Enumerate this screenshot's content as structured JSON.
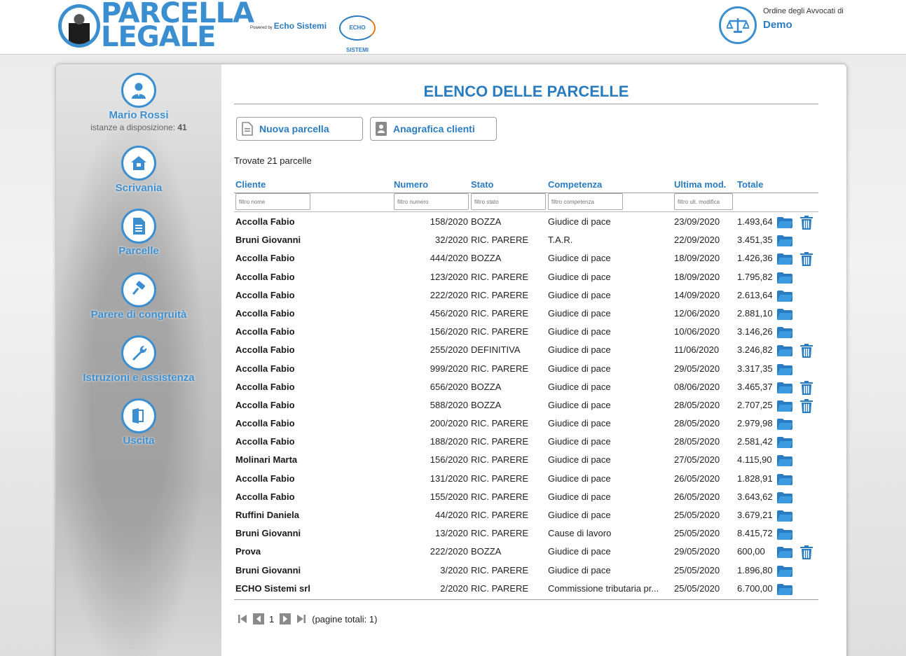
{
  "header": {
    "logo_line1_a": "PARCELLA",
    "logo_line2": "LEGALE",
    "powered_by": "Powered by",
    "powered_brand": "Echo Sistemi",
    "echo_logo_text": "ECHO SISTEMI",
    "order_label": "Ordine degli Avvocati di",
    "order_name": "Demo"
  },
  "sidebar": {
    "user_name": "Mario Rossi",
    "instances_label": "istanze a disposizione:",
    "instances_count": "41",
    "items": [
      {
        "label": "Scrivania",
        "icon": "house-icon"
      },
      {
        "label": "Parcelle",
        "icon": "document-icon"
      },
      {
        "label": "Parere di congruità",
        "icon": "gavel-icon"
      },
      {
        "label": "Istruzioni e assistenza",
        "icon": "wrench-icon"
      },
      {
        "label": "Uscita",
        "icon": "exit-door-icon"
      }
    ]
  },
  "main": {
    "title": "ELENCO DELLE PARCELLE",
    "new_button": "Nuova parcella",
    "clients_button": "Anagrafica clienti",
    "found_text": "Trovate 21 parcelle",
    "columns": {
      "cliente": "Cliente",
      "numero": "Numero",
      "stato": "Stato",
      "competenza": "Competenza",
      "ultima_mod": "Ultima mod.",
      "totale": "Totale"
    },
    "filters": {
      "nome": "filtro nome",
      "numero": "filtro numero",
      "stato": "filtro stato",
      "competenza": "filtro competenza",
      "ult_modifica": "filtro ult. modifica"
    },
    "rows": [
      {
        "cliente": "Accolla Fabio",
        "numero": "158/2020",
        "stato": "BOZZA",
        "competenza": "Giudice di pace",
        "data": "23/09/2020",
        "totale": "1.493,64",
        "deletable": true
      },
      {
        "cliente": "Bruni Giovanni",
        "numero": "32/2020",
        "stato": "RIC. PARERE",
        "competenza": "T.A.R.",
        "data": "22/09/2020",
        "totale": "3.451,35",
        "deletable": false
      },
      {
        "cliente": "Accolla Fabio",
        "numero": "444/2020",
        "stato": "BOZZA",
        "competenza": "Giudice di pace",
        "data": "18/09/2020",
        "totale": "1.426,36",
        "deletable": true
      },
      {
        "cliente": "Accolla Fabio",
        "numero": "123/2020",
        "stato": "RIC. PARERE",
        "competenza": "Giudice di pace",
        "data": "18/09/2020",
        "totale": "1.795,82",
        "deletable": false
      },
      {
        "cliente": "Accolla Fabio",
        "numero": "222/2020",
        "stato": "RIC. PARERE",
        "competenza": "Giudice di pace",
        "data": "14/09/2020",
        "totale": "2.613,64",
        "deletable": false
      },
      {
        "cliente": "Accolla Fabio",
        "numero": "456/2020",
        "stato": "RIC. PARERE",
        "competenza": "Giudice di pace",
        "data": "12/06/2020",
        "totale": "2.881,10",
        "deletable": false
      },
      {
        "cliente": "Accolla Fabio",
        "numero": "156/2020",
        "stato": "RIC. PARERE",
        "competenza": "Giudice di pace",
        "data": "10/06/2020",
        "totale": "3.146,26",
        "deletable": false
      },
      {
        "cliente": "Accolla Fabio",
        "numero": "255/2020",
        "stato": "DEFINITIVA",
        "competenza": "Giudice di pace",
        "data": "11/06/2020",
        "totale": "3.246,82",
        "deletable": true
      },
      {
        "cliente": "Accolla Fabio",
        "numero": "999/2020",
        "stato": "RIC. PARERE",
        "competenza": "Giudice di pace",
        "data": "29/05/2020",
        "totale": "3.317,35",
        "deletable": false
      },
      {
        "cliente": "Accolla Fabio",
        "numero": "656/2020",
        "stato": "BOZZA",
        "competenza": "Giudice di pace",
        "data": "08/06/2020",
        "totale": "3.465,37",
        "deletable": true
      },
      {
        "cliente": "Accolla Fabio",
        "numero": "588/2020",
        "stato": "BOZZA",
        "competenza": "Giudice di pace",
        "data": "28/05/2020",
        "totale": "2.707,25",
        "deletable": true
      },
      {
        "cliente": "Accolla Fabio",
        "numero": "200/2020",
        "stato": "RIC. PARERE",
        "competenza": "Giudice di pace",
        "data": "28/05/2020",
        "totale": "2.979,98",
        "deletable": false
      },
      {
        "cliente": "Accolla Fabio",
        "numero": "188/2020",
        "stato": "RIC. PARERE",
        "competenza": "Giudice di pace",
        "data": "28/05/2020",
        "totale": "2.581,42",
        "deletable": false
      },
      {
        "cliente": "Molinari Marta",
        "numero": "156/2020",
        "stato": "RIC. PARERE",
        "competenza": "Giudice di pace",
        "data": "27/05/2020",
        "totale": "4.115,90",
        "deletable": false
      },
      {
        "cliente": "Accolla Fabio",
        "numero": "131/2020",
        "stato": "RIC. PARERE",
        "competenza": "Giudice di pace",
        "data": "26/05/2020",
        "totale": "1.828,91",
        "deletable": false
      },
      {
        "cliente": "Accolla Fabio",
        "numero": "155/2020",
        "stato": "RIC. PARERE",
        "competenza": "Giudice di pace",
        "data": "26/05/2020",
        "totale": "3.643,62",
        "deletable": false
      },
      {
        "cliente": "Ruffini Daniela",
        "numero": "44/2020",
        "stato": "RIC. PARERE",
        "competenza": "Giudice di pace",
        "data": "25/05/2020",
        "totale": "3.679,21",
        "deletable": false
      },
      {
        "cliente": "Bruni Giovanni",
        "numero": "13/2020",
        "stato": "RIC. PARERE",
        "competenza": "Cause di lavoro",
        "data": "25/05/2020",
        "totale": "8.415,72",
        "deletable": false
      },
      {
        "cliente": "Prova",
        "numero": "222/2020",
        "stato": "BOZZA",
        "competenza": "Giudice di pace",
        "data": "29/05/2020",
        "totale": "600,00",
        "deletable": true
      },
      {
        "cliente": "Bruni Giovanni",
        "numero": "3/2020",
        "stato": "RIC. PARERE",
        "competenza": "Giudice di pace",
        "data": "25/05/2020",
        "totale": "1.896,80",
        "deletable": false
      },
      {
        "cliente": "ECHO Sistemi srl",
        "numero": "2/2020",
        "stato": "RIC. PARERE",
        "competenza": "Commissione tributaria pr...",
        "data": "25/05/2020",
        "totale": "6.700,00",
        "deletable": false
      }
    ],
    "pager": {
      "current_page": "1",
      "total_text": "(pagine totali: 1)"
    }
  },
  "colors": {
    "accent": "#2a7cc0",
    "icon_blue": "#3b8fd0"
  }
}
